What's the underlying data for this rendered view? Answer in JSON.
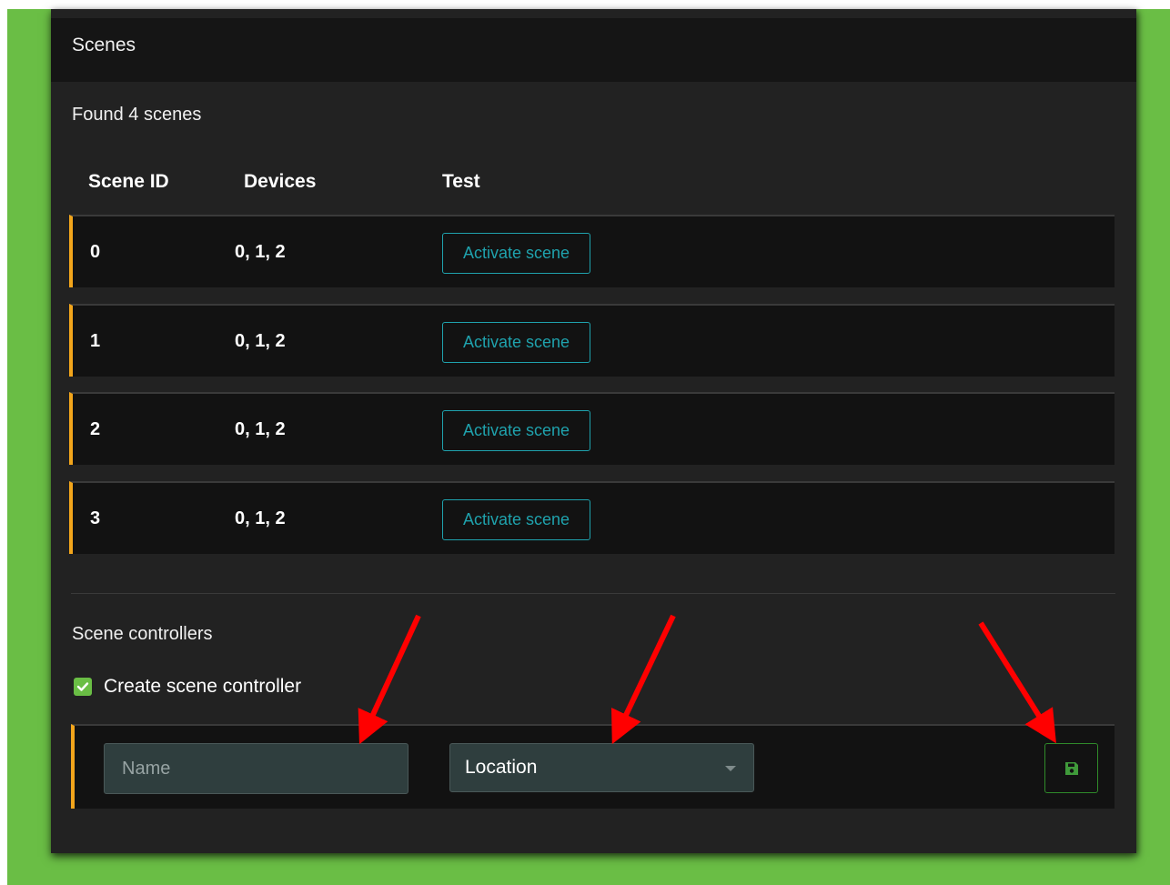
{
  "panel": {
    "title": "Scenes"
  },
  "scenes": {
    "found_text": "Found 4 scenes",
    "columns": {
      "scene_id": "Scene ID",
      "devices": "Devices",
      "test": "Test"
    },
    "rows": [
      {
        "id": "0",
        "devices": "0, 1, 2",
        "action_label": "Activate scene"
      },
      {
        "id": "1",
        "devices": "0, 1, 2",
        "action_label": "Activate scene"
      },
      {
        "id": "2",
        "devices": "0, 1, 2",
        "action_label": "Activate scene"
      },
      {
        "id": "3",
        "devices": "0, 1, 2",
        "action_label": "Activate scene"
      }
    ]
  },
  "controllers": {
    "title": "Scene controllers",
    "create_checkbox": {
      "label": "Create scene controller",
      "checked": true
    },
    "name_input": {
      "placeholder": "Name",
      "value": ""
    },
    "location_select": {
      "selected": "Location"
    },
    "save_button": {
      "icon": "save-icon"
    }
  },
  "annotations": {
    "arrow_color": "#ff0000",
    "arrow_count": 3
  },
  "colors": {
    "background": "#6abe45",
    "panel": "#222222",
    "header": "#151515",
    "row": "#121212",
    "row_accent": "#f2a51b",
    "button_teal": "#1fa2ad",
    "save_green": "#2f8a2a"
  }
}
